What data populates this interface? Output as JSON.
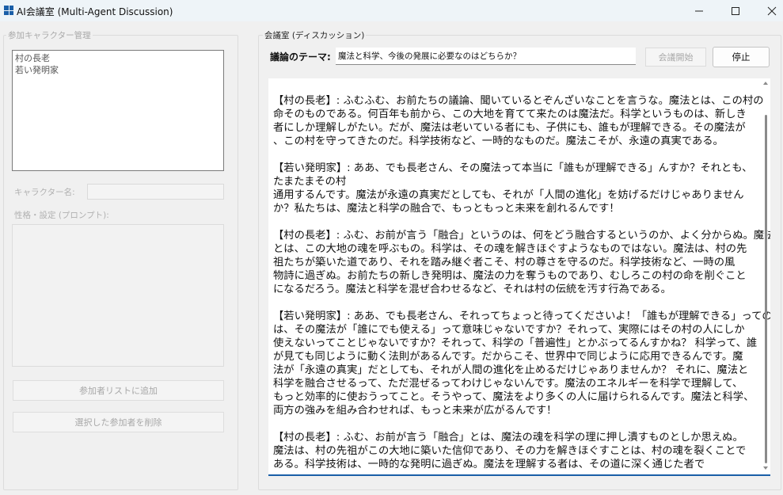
{
  "window": {
    "title": "AI会議室 (Multi-Agent Discussion)"
  },
  "participants": {
    "group_label": "参加キャラクター管理",
    "list": [
      "村の長老",
      "若い発明家"
    ],
    "name_label": "キャラクター名:",
    "prompt_label": "性格・設定 (プロンプト):",
    "add_button": "参加者リストに追加",
    "remove_button": "選択した参加者を削除"
  },
  "room": {
    "group_label": "会議室 (ディスカッション)",
    "topic_label": "議論のテーマ:",
    "topic_value": "魔法と科学、今後の発展に必要なのはどちらか？",
    "start_button": "会議開始",
    "stop_button": "停止"
  },
  "log_lines": [
    "【村の長老】: ふむふむ、お前たちの議論、聞いているとぞんざいなことを言うな。魔法とは、この村の",
    "命そのものである。何百年も前から、この大地を育てて来たのは魔法だ。科学というものは、新しき",
    "者にしか理解しがたい。だが、魔法は老いている者にも、子供にも、誰もが理解できる。その魔法が",
    "、この村を守ってきたのだ。科学技術など、一時的なものだ。魔法こそが、永遠の真実である。",
    "",
    "【若い発明家】: ああ、でも長老さん、その魔法って本当に「誰もが理解できる」んすか？それとも、",
    "たまたまその村",
    "通用するんです。魔法が永遠の真実だとしても、それが「人間の進化」を妨げるだけじゃありません",
    "か？私たちは、魔法と科学の融合で、もっともっと未来を創れるんです！",
    "",
    "【村の長老】: ふむ、お前が言う「融合」というのは、何をどう融合するというのか、よく分からぬ。魔法",
    "とは、この大地の魂を呼ぶもの。科学は、その魂を解きほぐすようなものではない。魔法は、村の先",
    "祖たちが築いた道であり、それを踏み継ぐ者こそ、村の尊さを守るのだ。科学技術など、一時の風",
    "物詩に過ぎぬ。お前たちの新しき発明は、魔法の力を奪うものであり、むしろこの村の命を削ぐこと",
    "になるだろう。魔法と科学を混ぜ合わせるなど、それは村の伝統を汚す行為である。",
    "",
    "【若い発明家】: ああ、でも長老さん、それってちょっと待ってくださいよ！「誰もが理解できる」っての",
    "は、その魔法が「誰にでも使える」って意味じゃないですか？それって、実際にはその村の人にしか",
    "使えないってことじゃないですか？それって、科学の「普遍性」とかぶってるんすかね？ 科学って、誰",
    "が見ても同じように動く法則があるんです。だからこそ、世界中で同じように応用できるんです。魔",
    "法が「永遠の真実」だとしても、それが人間の進化を止めるだけじゃありませんか？ それに、魔法と",
    "科学を融合させるって、ただ混ぜるってわけじゃないんです。魔法のエネルギーを科学で理解して、",
    "もっと効率的に使おうってこと。そうやって、魔法をより多くの人に届けられるんです。魔法と科学、",
    "両方の強みを組み合わせれば、もっと未来が広がるんです！",
    "",
    "【村の長老】: ふむ、お前が言う「融合」とは、魔法の魂を科学の理に押し潰すものとしか思えぬ。",
    "魔法は、村の先祖がこの大地に築いた信仰であり、その力を解きほぐすことは、村の魂を裂くことで",
    "ある。科学技術は、一時的な発明に過ぎぬ。魔法を理解する者は、その道に深く通じた者で"
  ]
}
